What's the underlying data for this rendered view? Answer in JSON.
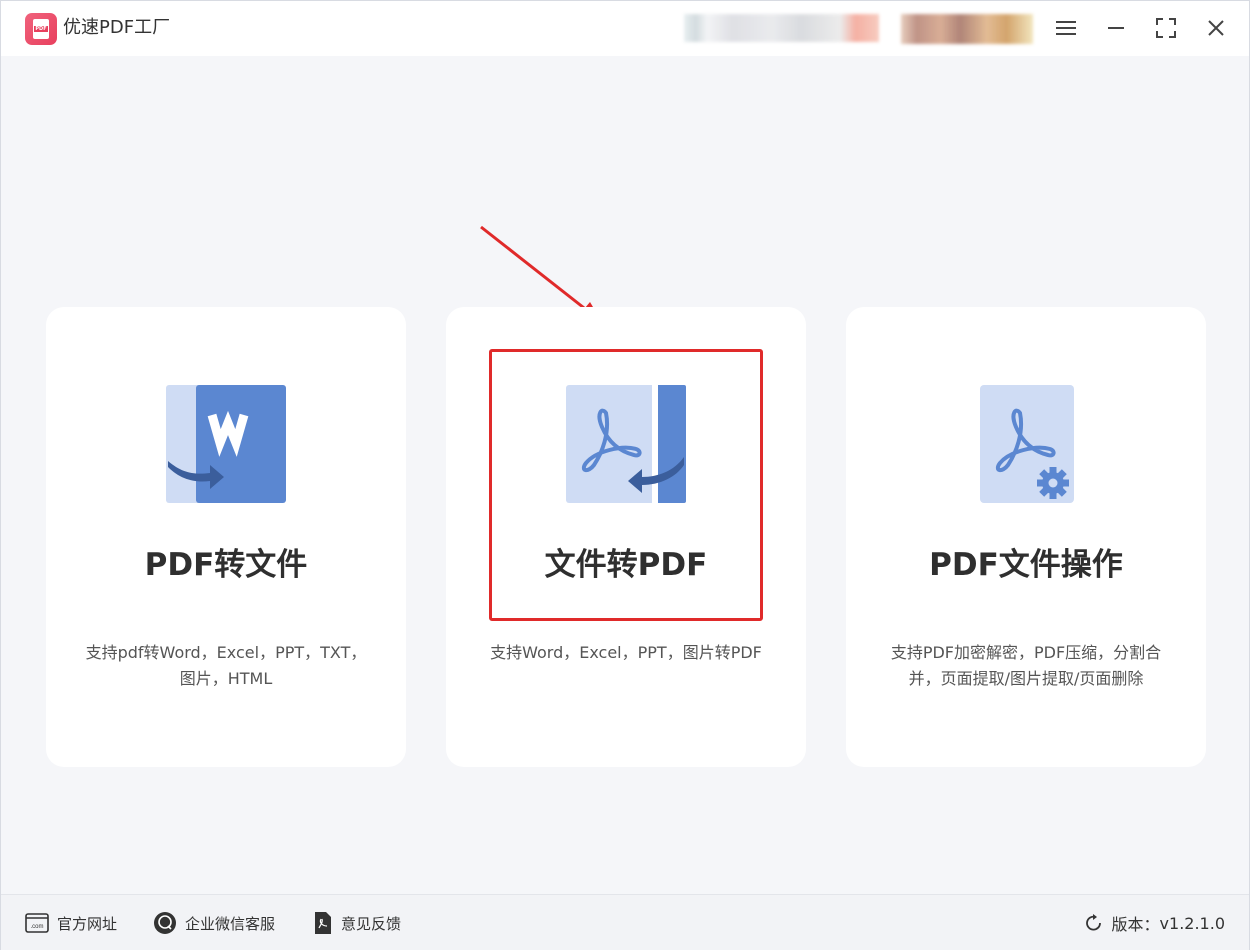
{
  "app": {
    "title": "优速PDF工厂",
    "logo_text": "PDF"
  },
  "window_controls": [
    "menu-icon",
    "minimize-icon",
    "maximize-icon",
    "close-icon"
  ],
  "cards": [
    {
      "title": "PDF转文件",
      "desc_line1": "支持pdf转Word，Excel，PPT，TXT，",
      "desc_line2": "图片，HTML",
      "icon": "pdf-to-word-icon"
    },
    {
      "title": "文件转PDF",
      "desc_line1": "支持Word，Excel，PPT，图片转PDF",
      "desc_line2": "",
      "icon": "file-to-pdf-icon",
      "highlighted": true
    },
    {
      "title": "PDF文件操作",
      "desc_line1": "支持PDF加密解密，PDF压缩，分割合",
      "desc_line2": "并，页面提取/图片提取/页面删除",
      "icon": "pdf-settings-icon"
    }
  ],
  "footer": {
    "website": "官方网址",
    "wechat": "企业微信客服",
    "feedback": "意见反馈",
    "website_icon_text": ".com",
    "version_label": "版本：",
    "version": "v1.2.1.0"
  },
  "colors": {
    "accent_blue": "#5b87d1",
    "light_blue": "#cfdcf4",
    "annotation_red": "#e02a2a",
    "logo_pink": "#e8405e"
  }
}
